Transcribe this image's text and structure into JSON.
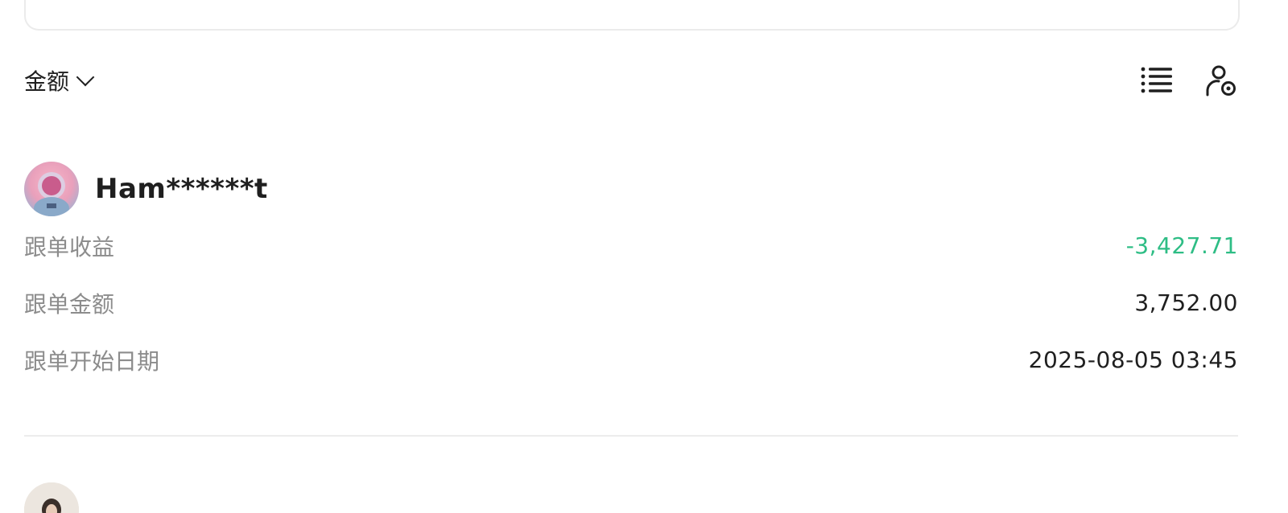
{
  "sort": {
    "label": "金额"
  },
  "toolbar": {
    "list_icon": "list-icon",
    "settings_icon": "user-settings-icon"
  },
  "trader": {
    "name": "Ham******t",
    "stats": [
      {
        "label": "跟单收益",
        "value": "-3,427.71",
        "status": "negative"
      },
      {
        "label": "跟单金额",
        "value": "3,752.00",
        "status": "neutral"
      },
      {
        "label": "跟单开始日期",
        "value": "2025-08-05 03:45",
        "status": "neutral"
      }
    ]
  },
  "colors": {
    "negative": "#2ebd85",
    "label": "#8c8c8c",
    "text": "#1f1f1f",
    "divider": "#ececec"
  }
}
